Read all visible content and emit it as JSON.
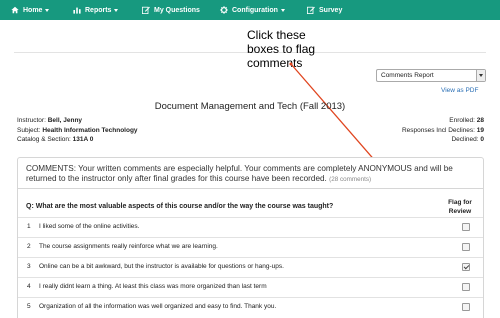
{
  "nav": {
    "home": "Home",
    "reports": "Reports",
    "my_questions": "My Questions",
    "configuration": "Configuration",
    "survey": "Survey",
    "bar_color": "#17997f"
  },
  "callout": {
    "line1": "Click these",
    "line2": "boxes to flag",
    "line3": "comments",
    "arrow_color": "#e0451f"
  },
  "report_select": {
    "selected": "Comments Report"
  },
  "view_pdf": "View as PDF",
  "course": {
    "title": "Document Management and Tech (Fall 2013)",
    "instructor_label": "Instructor:",
    "instructor": "Bell, Jenny",
    "subject_label": "Subject:",
    "subject": "Health Information Technology",
    "catalog_label": "Catalog & Section:",
    "catalog": "131A 0",
    "enrolled_label": "Enrolled:",
    "enrolled": "28",
    "responses_label": "Responses Incl Declines:",
    "responses": "19",
    "declined_label": "Declined:",
    "declined": "0"
  },
  "comments": {
    "note_line1": "COMMENTS: Your written comments are especially helpful. Your comments are completely ANONYMOUS and will be",
    "note_line2": "returned to the instructor only after final grades for this course have been recorded.",
    "count": "(28 comments)",
    "question": "Q: What are the most valuable aspects of this course and/or the way the course was taught?",
    "flag_header_1": "Flag for",
    "flag_header_2": "Review",
    "rows": [
      {
        "num": "1",
        "text": "I liked some of the online activities.",
        "flagged": false
      },
      {
        "num": "2",
        "text": "The course assignments really reinforce what we are learning.",
        "flagged": false
      },
      {
        "num": "3",
        "text": "Online can be a bit awkward, but the instructor is available for questions or hang-ups.",
        "flagged": true
      },
      {
        "num": "4",
        "text": "I really didnt learn a thing. At least this class was more organized than last term",
        "flagged": false
      },
      {
        "num": "5",
        "text": "Organization of all the information was well organized and easy to find. Thank you.",
        "flagged": false
      }
    ]
  }
}
